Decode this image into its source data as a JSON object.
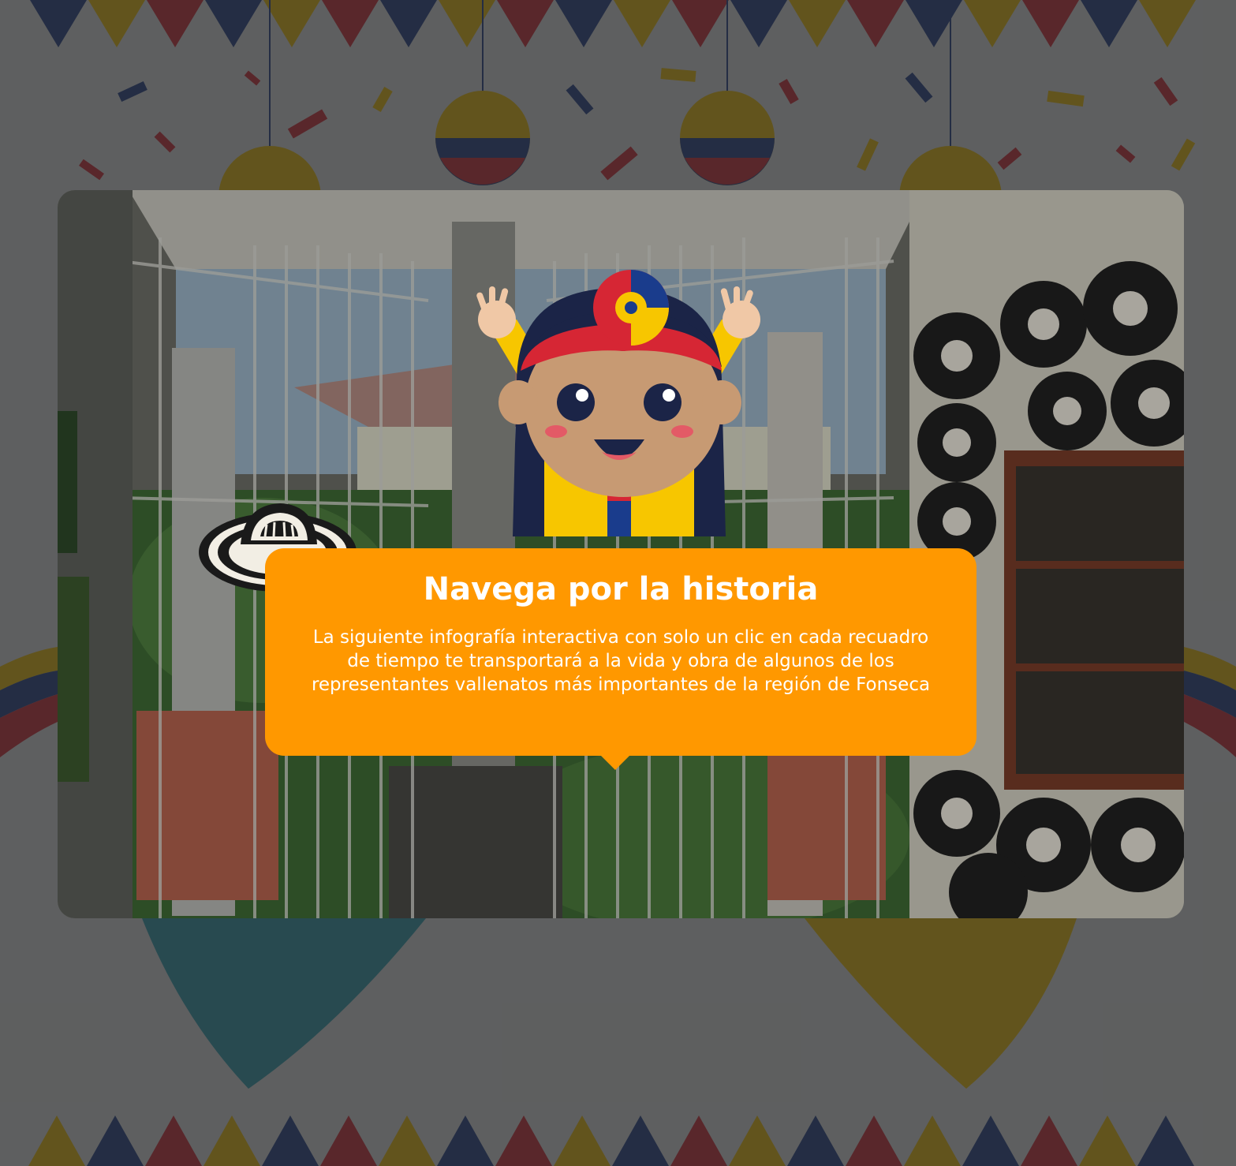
{
  "dialog": {
    "title": "Navega por la historia",
    "body": "La siguiente infografía interactiva con solo un clic en cada recuadro de tiempo te transportará a la vida y obra de algunos de los representantes vallenatos más importantes de la región de Fonseca"
  },
  "colors": {
    "dialog_bg": "#ff9800",
    "flag_yellow": "#f7c600",
    "flag_blue": "#1a3c8c",
    "flag_red": "#d62634",
    "background": "#e9ecef"
  },
  "icons": {
    "mascot": "mascot-character-icon",
    "hat": "sombrero-vueltiao-icon"
  }
}
